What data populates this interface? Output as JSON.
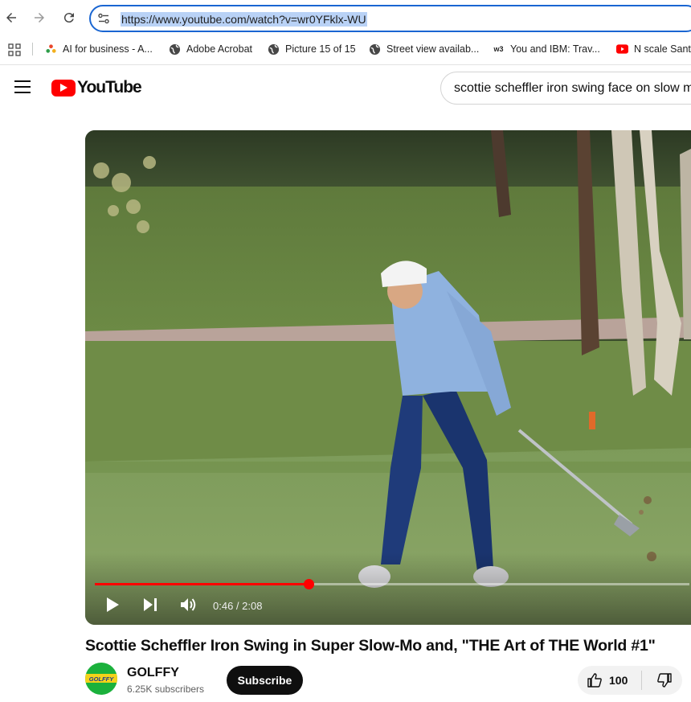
{
  "browser": {
    "url": "https://www.youtube.com/watch?v=wr0YFklx-WU",
    "bookmarks": [
      {
        "label": "AI for business - A...",
        "icon": "ibm-flower-icon"
      },
      {
        "label": "Adobe Acrobat",
        "icon": "globe-icon"
      },
      {
        "label": "Picture 15 of 15",
        "icon": "globe-icon"
      },
      {
        "label": "Street view availab...",
        "icon": "globe-icon"
      },
      {
        "label": "You and IBM: Trav...",
        "icon": "w3-icon",
        "icon_text": "w3"
      },
      {
        "label": "N scale Sant",
        "icon": "youtube-icon"
      }
    ]
  },
  "youtube": {
    "logo_text": "YouTube",
    "search_query": "scottie scheffler iron swing face on slow motion"
  },
  "player": {
    "current_time": "0:46",
    "duration": "2:08",
    "time_display": "0:46 / 2:08",
    "progress_fraction": 0.36
  },
  "video": {
    "title": "Scottie Scheffler Iron Swing in Super Slow-Mo and, \"THE Art of THE World #1\"",
    "channel_name": "GOLFFY",
    "avatar_text": "GOLFFY",
    "subscribers": "6.25K subscribers",
    "subscribe_label": "Subscribe",
    "like_count": "100"
  },
  "colors": {
    "accent_blue": "#1a66d2",
    "youtube_red": "#ff0000",
    "progress_red": "#ff0000"
  }
}
